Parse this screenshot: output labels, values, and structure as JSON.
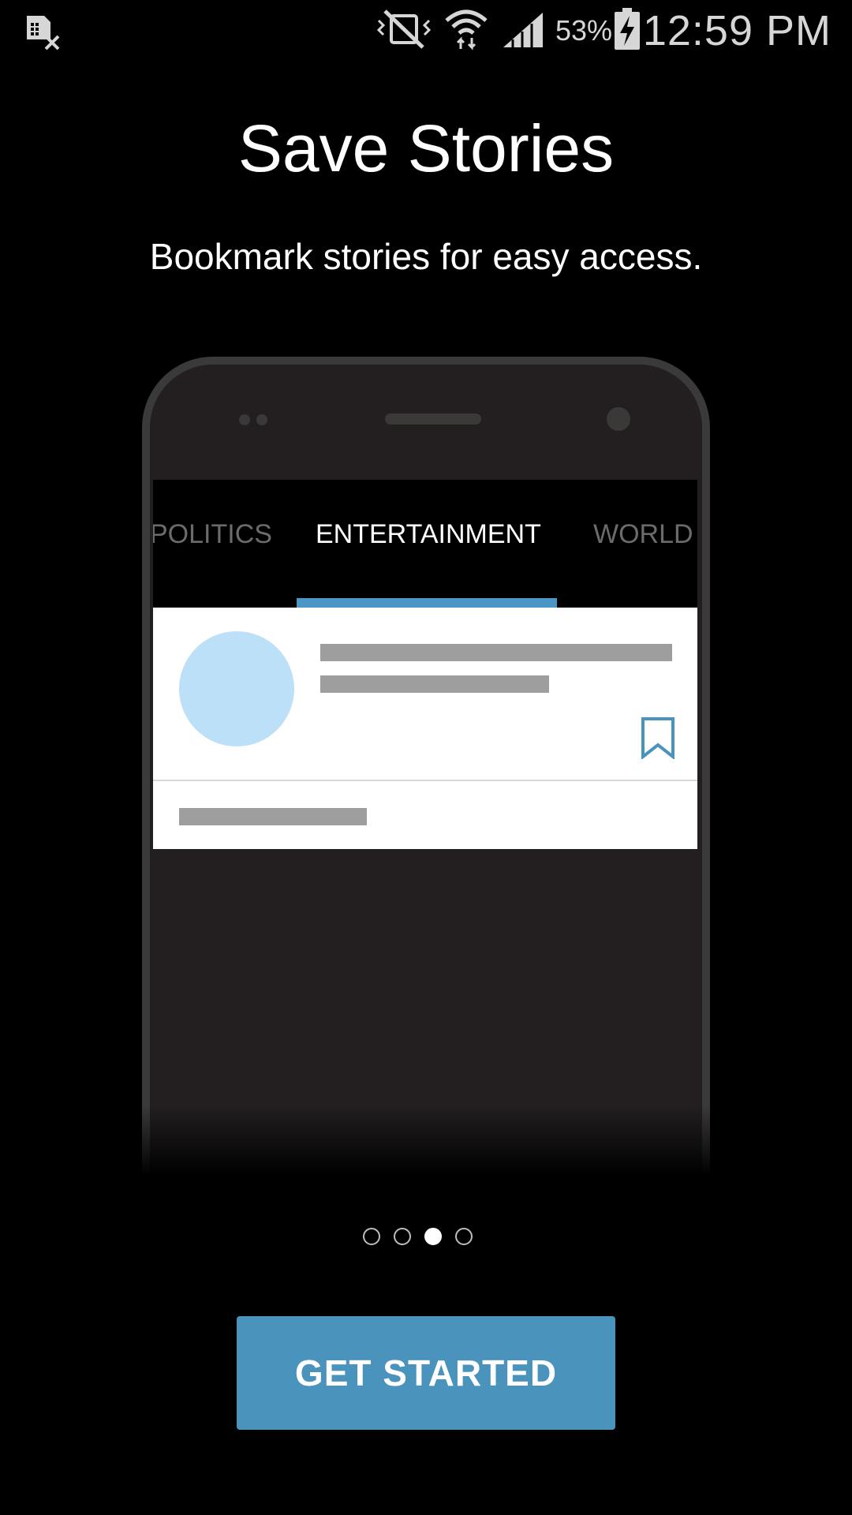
{
  "status_bar": {
    "battery_percent": "53%",
    "time": "12:59 PM",
    "icons": [
      "sim-error-icon",
      "vibrate-mute-icon",
      "wifi-icon",
      "cell-signal-icon",
      "battery-charging-icon"
    ]
  },
  "onboarding": {
    "title": "Save Stories",
    "subtitle": "Bookmark stories for easy access.",
    "page_index": 2,
    "page_count": 4
  },
  "illustration": {
    "tabs": [
      {
        "label": "POLITICS",
        "active": false
      },
      {
        "label": "ENTERTAINMENT",
        "active": true
      },
      {
        "label": "WORLD",
        "active": false
      }
    ],
    "bookmark_icon": "bookmark-outline-icon"
  },
  "cta": {
    "label": "GET STARTED"
  },
  "colors": {
    "accent": "#4a93bd",
    "tab_indicator": "#4a96c4",
    "thumbnail": "#bde0f9",
    "background": "#000000"
  }
}
